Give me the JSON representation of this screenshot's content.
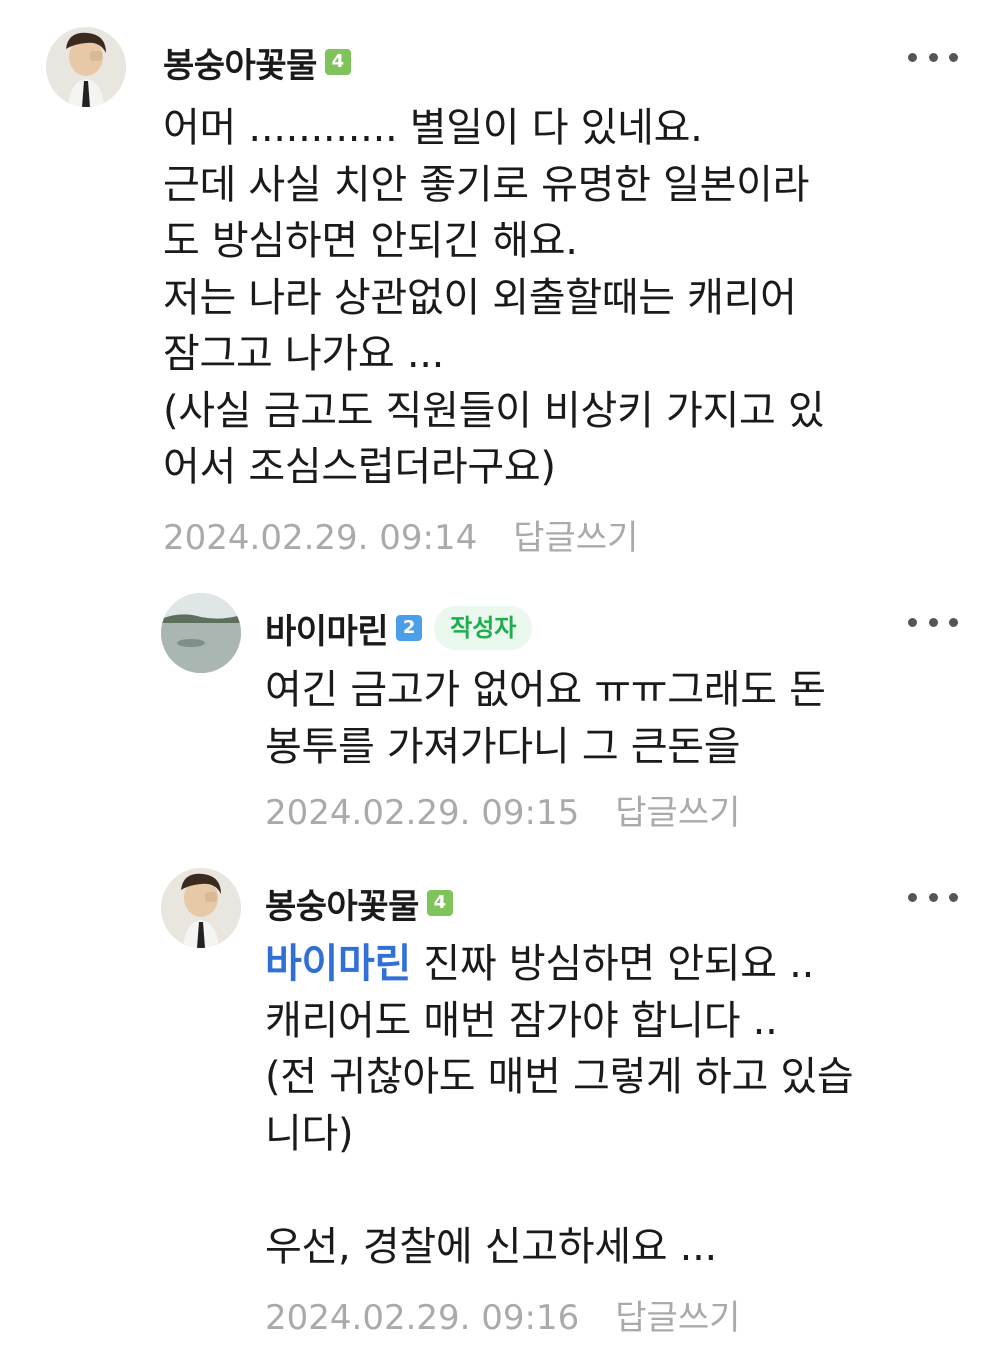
{
  "comments": [
    {
      "nickname": "봉숭아꽃물",
      "level": "4",
      "lines": [
        "어머 ............ 별일이 다 있네요.",
        "근데 사실 치안 좋기로 유명한 일본이라",
        "도 방심하면 안되긴 해요.",
        "저는 나라 상관없이 외출할때는 캐리어",
        "잠그고 나가요 ...",
        "(사실 금고도 직원들이 비상키 가지고 있",
        "어서 조심스럽더라구요)"
      ],
      "date": "2024.02.29. 09:14",
      "reply_label": "답글쓰기"
    },
    {
      "nickname": "바이마린",
      "level": "2",
      "author_badge": "작성자",
      "lines": [
        "여긴 금고가 없어요 ㅠㅠ그래도 돈",
        "봉투를 가져가다니 그 큰돈을"
      ],
      "date": "2024.02.29. 09:15",
      "reply_label": "답글쓰기"
    },
    {
      "nickname": "봉숭아꽃물",
      "level": "4",
      "mention": "바이마린",
      "first_line_rest": " 진짜 방심하면 안되요 ..",
      "lines": [
        "캐리어도 매번 잠가야 합니다 ..",
        "(전 귀찮아도 매번 그렇게 하고 있습",
        "니다)",
        "",
        "우선, 경찰에 신고하세요 ..."
      ],
      "date": "2024.02.29. 09:16",
      "reply_label": "답글쓰기"
    }
  ],
  "icons": {
    "more": "more-icon",
    "avatar_person": "profile-photo-person",
    "avatar_lake": "profile-photo-lake"
  },
  "colors": {
    "level_green": "#7ec45a",
    "level_blue": "#4a9fe8",
    "author_badge_text": "#1fae4f",
    "mention": "#2f6fd6",
    "meta": "#aaaaaa"
  }
}
